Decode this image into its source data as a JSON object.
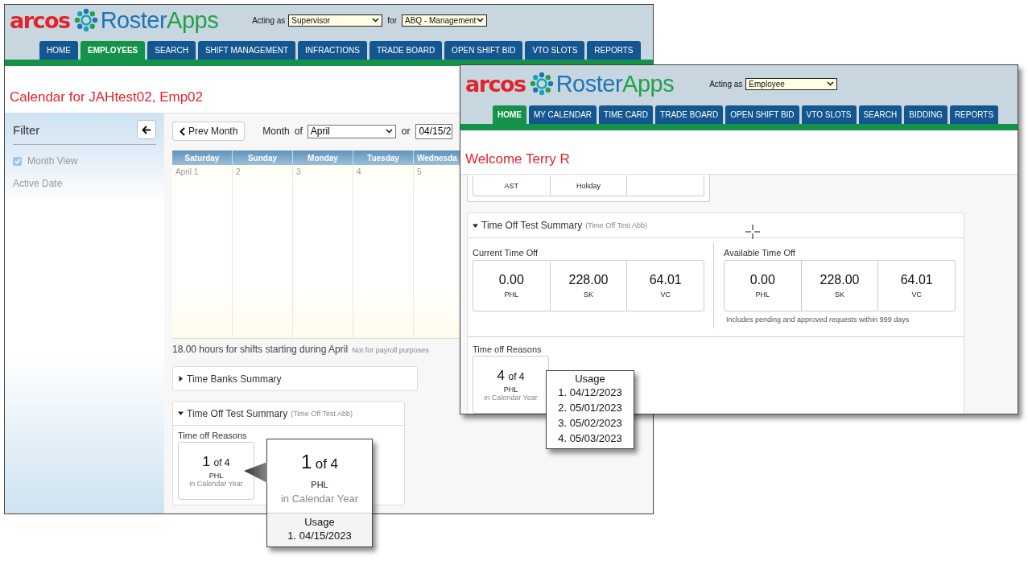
{
  "calendar_window": {
    "logo": {
      "brand": "arcos",
      "product_a": "Roster",
      "product_b": "Apps"
    },
    "acting_as": {
      "label": "Acting as",
      "value": "Supervisor"
    },
    "for": {
      "label": "for",
      "value": "ABQ - Management"
    },
    "tabs": [
      {
        "label": "HOME",
        "selected": false
      },
      {
        "label": "EMPLOYEES",
        "selected": true
      },
      {
        "label": "SEARCH",
        "selected": false
      },
      {
        "label": "SHIFT MANAGEMENT",
        "selected": false
      },
      {
        "label": "INFRACTIONS",
        "selected": false
      },
      {
        "label": "TRADE BOARD",
        "selected": false
      },
      {
        "label": "OPEN SHIFT BID",
        "selected": false
      },
      {
        "label": "VTO SLOTS",
        "selected": false
      },
      {
        "label": "REPORTS",
        "selected": false
      }
    ],
    "title": "Calendar for JAHtest02, Emp02",
    "filter": {
      "title": "Filter",
      "options": [
        {
          "label": "Month View",
          "checked": true
        }
      ],
      "faded_label": "Active Date"
    },
    "toolbar": {
      "prev": "Prev Month",
      "month_label": "Month",
      "of_label": "of",
      "month": "April",
      "or_label": "or",
      "date": "04/15/2"
    },
    "calendar": {
      "days": [
        "Saturday",
        "Sunday",
        "Monday",
        "Tuesday",
        "Wednesda"
      ],
      "dates": [
        "April 1",
        "2",
        "3",
        "4",
        "5"
      ]
    },
    "hours": {
      "text": "18.00 hours for shifts starting during April",
      "note": "Not for payroll purposes"
    },
    "sections": [
      {
        "title": "Time Banks Summary",
        "expanded": false
      },
      {
        "title": "Time Off Test Summary",
        "abbr": "(Time Off Test Abb)",
        "expanded": true,
        "reasons_label": "Time off Reasons",
        "cards": [
          {
            "count": "1",
            "of": "of 4",
            "code": "PHL",
            "period": "in Calendar Year"
          }
        ]
      }
    ]
  },
  "home_window": {
    "logo": {
      "brand": "arcos",
      "product_a": "Roster",
      "product_b": "Apps"
    },
    "acting_as": {
      "label": "Acting as",
      "value": "Employee"
    },
    "tabs": [
      {
        "label": "HOME",
        "selected": true
      },
      {
        "label": "MY CALENDAR",
        "selected": false
      },
      {
        "label": "TIME CARD",
        "selected": false
      },
      {
        "label": "TRADE BOARD",
        "selected": false
      },
      {
        "label": "OPEN SHIFT BID",
        "selected": false
      },
      {
        "label": "VTO SLOTS",
        "selected": false
      },
      {
        "label": "SEARCH",
        "selected": false
      },
      {
        "label": "BIDDING",
        "selected": false
      },
      {
        "label": "REPORTS",
        "selected": false
      }
    ],
    "welcome": "Welcome Terry R",
    "top_cells": [
      "AST",
      "Holiday"
    ],
    "summary": {
      "title": "Time Off Test Summary",
      "abbr": "(Time Off Test Abb)",
      "expanded": true,
      "current": {
        "label": "Current Time Off",
        "items": [
          {
            "value": "0.00",
            "code": "PHL"
          },
          {
            "value": "228.00",
            "code": "SK"
          },
          {
            "value": "64.01",
            "code": "VC"
          }
        ]
      },
      "available": {
        "label": "Available Time Off",
        "items": [
          {
            "value": "0.00",
            "code": "PHL"
          },
          {
            "value": "228.00",
            "code": "SK"
          },
          {
            "value": "64.01",
            "code": "VC"
          }
        ],
        "note": "Includes pending and approved requests within 999 days"
      },
      "reasons_label": "Time off Reasons",
      "cards": [
        {
          "count": "4",
          "of": "of 4",
          "code": "PHL",
          "period": "in Calendar Year"
        }
      ]
    }
  },
  "popups": [
    {
      "kind": "detail",
      "count": "1",
      "of": "of 4",
      "code": "PHL",
      "period": "in Calendar Year",
      "usage_label": "Usage",
      "usage": [
        "1. 04/15/2023"
      ]
    },
    {
      "kind": "usage",
      "usage_label": "Usage",
      "usage": [
        "1. 04/12/2023",
        "2. 05/01/2023",
        "3. 05/02/2023",
        "4. 05/03/2023"
      ]
    }
  ]
}
